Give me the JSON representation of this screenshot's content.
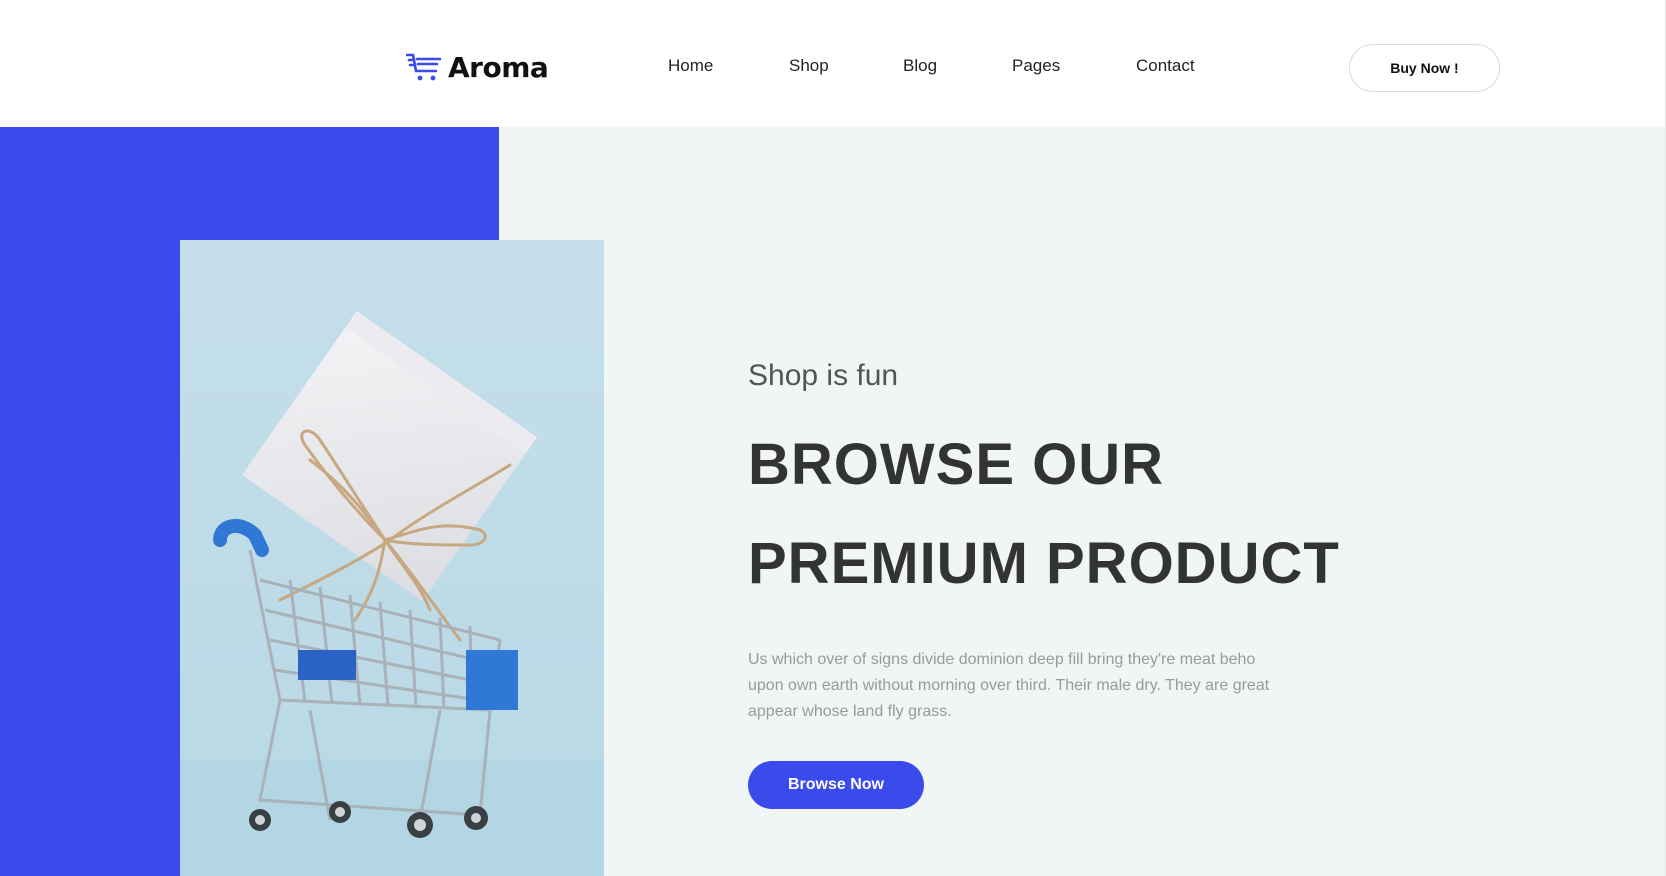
{
  "brand": {
    "name": "Aroma",
    "logo_icon": "shopping-cart-icon",
    "accent_color": "#3a4aeb"
  },
  "nav": {
    "items": [
      {
        "label": "Home"
      },
      {
        "label": "Shop"
      },
      {
        "label": "Blog"
      },
      {
        "label": "Pages"
      },
      {
        "label": "Contact"
      }
    ],
    "cta_label": "Buy Now !"
  },
  "hero": {
    "subtitle": "Shop is fun",
    "title_line1": "BROWSE OUR",
    "title_line2": "PREMIUM PRODUCT",
    "description": "Us which over of signs divide dominion deep fill bring they're meat beho upon own earth without morning over third. Their male dry. They are great appear whose land fly grass.",
    "button_label": "Browse Now",
    "image_alt": "gift-box-in-shopping-cart",
    "background_color": "#f0f5f5",
    "image_background": "#c6dfe9"
  }
}
